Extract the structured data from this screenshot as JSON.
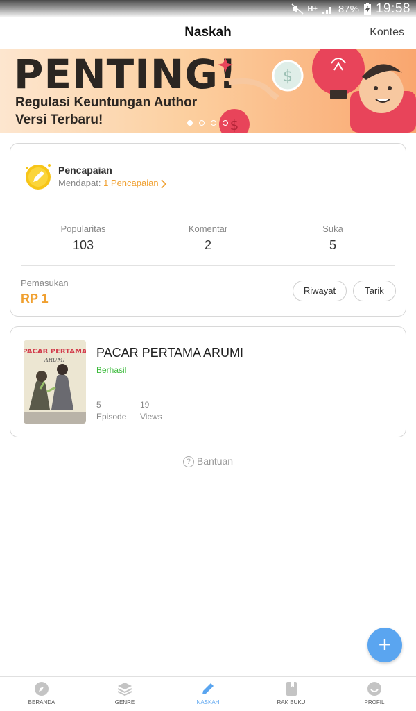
{
  "status_bar": {
    "battery": "87%",
    "time": "19:58",
    "network": "H+"
  },
  "header": {
    "title": "Naskah",
    "contest_link": "Kontes"
  },
  "banner": {
    "headline": "PENTING!",
    "line1": "Regulasi Keuntungan Author",
    "line2": "Versi Terbaru!",
    "slides": 4,
    "active_slide": 1
  },
  "achievement": {
    "title": "Pencapaian",
    "meta_prefix": "Mendapat:",
    "meta_link": "1 Pencapaian"
  },
  "stats": [
    {
      "label": "Popularitas",
      "value": "103"
    },
    {
      "label": "Komentar",
      "value": "2"
    },
    {
      "label": "Suka",
      "value": "5"
    }
  ],
  "income": {
    "label": "Pemasukan",
    "value": "RP 1",
    "history_button": "Riwayat",
    "withdraw_button": "Tarik"
  },
  "book": {
    "title": "PACAR PERTAMA ARUMI",
    "status": "Berhasil",
    "cover_title": "PACAR PERTAMA",
    "cover_sub": "ARUMI",
    "episodes_value": "5",
    "episodes_label": "Episode",
    "views_value": "19",
    "views_label": "Views"
  },
  "help_link": "Bantuan",
  "fab_label": "+",
  "nav": {
    "beranda": "BERANDA",
    "genre": "GENRE",
    "naskah": "NASKAH",
    "rak_buku": "RAK BUKU",
    "profil": "PROFIL"
  },
  "colors": {
    "accent": "#f0a030",
    "primary": "#5aa5f0",
    "success": "#3dbb3d"
  }
}
